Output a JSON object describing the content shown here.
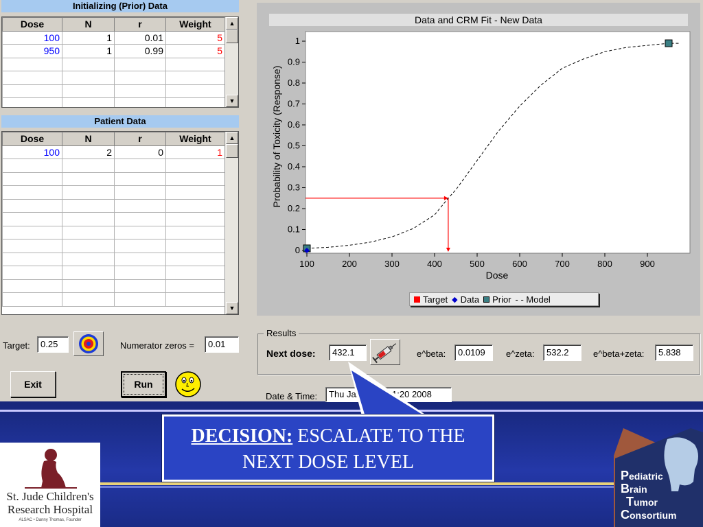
{
  "prior_panel": {
    "title": "Initializing (Prior) Data",
    "columns": [
      "Dose",
      "N",
      "r",
      "Weight"
    ],
    "rows": [
      {
        "dose": "100",
        "n": "1",
        "r": "0.01",
        "weight": "5"
      },
      {
        "dose": "950",
        "n": "1",
        "r": "0.99",
        "weight": "5"
      }
    ]
  },
  "patient_panel": {
    "title": "Patient Data",
    "columns": [
      "Dose",
      "N",
      "r",
      "Weight"
    ],
    "rows": [
      {
        "dose": "100",
        "n": "2",
        "r": "0",
        "weight": "1"
      }
    ]
  },
  "controls": {
    "target_label": "Target:",
    "target_value": "0.25",
    "numerator_label": "Numerator zeros =",
    "numerator_value": "0.01",
    "exit_label": "Exit",
    "run_label": "Run"
  },
  "chart_data": {
    "type": "line",
    "title": "Data and CRM Fit - New Data",
    "xlabel": "Dose",
    "ylabel": "Probability of Toxicity (Response)",
    "xlim": [
      100,
      1000
    ],
    "ylim": [
      0,
      1
    ],
    "x_ticks": [
      100,
      200,
      300,
      400,
      500,
      600,
      700,
      800,
      900
    ],
    "y_ticks": [
      0,
      0.1,
      0.2,
      0.3,
      0.4,
      0.5,
      0.6,
      0.7,
      0.8,
      0.9,
      1
    ],
    "y_tick_labels": [
      "0",
      "0.1",
      "0.2",
      "0.3",
      "0.4",
      "0.5",
      "0.6",
      "0.7",
      "0.8",
      "0.9",
      "1"
    ],
    "grid": false,
    "legend_position": "bottom-right",
    "series": [
      {
        "name": "Model",
        "style": "dashed",
        "color": "#000000",
        "x": [
          100,
          150,
          200,
          250,
          300,
          350,
          400,
          432.1,
          450,
          500,
          550,
          600,
          650,
          700,
          750,
          800,
          850,
          900,
          950,
          975
        ],
        "y": [
          0.01,
          0.015,
          0.025,
          0.04,
          0.065,
          0.105,
          0.17,
          0.25,
          0.29,
          0.43,
          0.57,
          0.69,
          0.79,
          0.87,
          0.915,
          0.95,
          0.97,
          0.98,
          0.99,
          0.99
        ]
      },
      {
        "name": "Data",
        "marker": "diamond",
        "color": "#0000cc",
        "x": [
          100
        ],
        "y": [
          0
        ]
      },
      {
        "name": "Prior",
        "marker": "square",
        "color": "#3a7f84",
        "x": [
          100,
          950
        ],
        "y": [
          0.01,
          0.99
        ]
      },
      {
        "name": "Target",
        "marker": "square",
        "color": "#ff0000",
        "target_y": 0.25,
        "target_x": 432.1
      }
    ],
    "legend": [
      "Target",
      "Data",
      "Prior",
      "- - Model"
    ]
  },
  "results": {
    "group_label": "Results",
    "next_dose_label": "Next dose:",
    "next_dose_value": "432.1",
    "ebeta_label": "e^beta:",
    "ebeta_value": "0.0109",
    "ezeta_label": "e^zeta:",
    "ezeta_value": "532.2",
    "ebz_label": "e^beta+zeta:",
    "ebz_value": "5.838",
    "datetime_label": "Date & Time:",
    "datetime_value": "Thu Jan 17 11:11:20 2008"
  },
  "callout": {
    "decision_label": "DECISION:",
    "decision_text": "ESCALATE TO THE NEXT DOSE LEVEL"
  },
  "logos": {
    "stjude_line1": "St. Jude Children's",
    "stjude_line2": "Research Hospital",
    "stjude_line3": "ALSAC • Danny Thomas, Founder",
    "pbtc_p": "P",
    "pbtc_p_rest": "ediatric",
    "pbtc_b": "B",
    "pbtc_b_rest": "rain",
    "pbtc_t": "T",
    "pbtc_t_rest": "umor",
    "pbtc_c": "C",
    "pbtc_c_rest": "onsortium"
  },
  "colors": {
    "header_blue": "#a6caf0",
    "dose_blue": "#0000ff",
    "weight_red": "#ff0000",
    "target_red": "#ff0000",
    "callout_bg": "#2a44c4",
    "slide_bg": "#1c2f8e"
  }
}
